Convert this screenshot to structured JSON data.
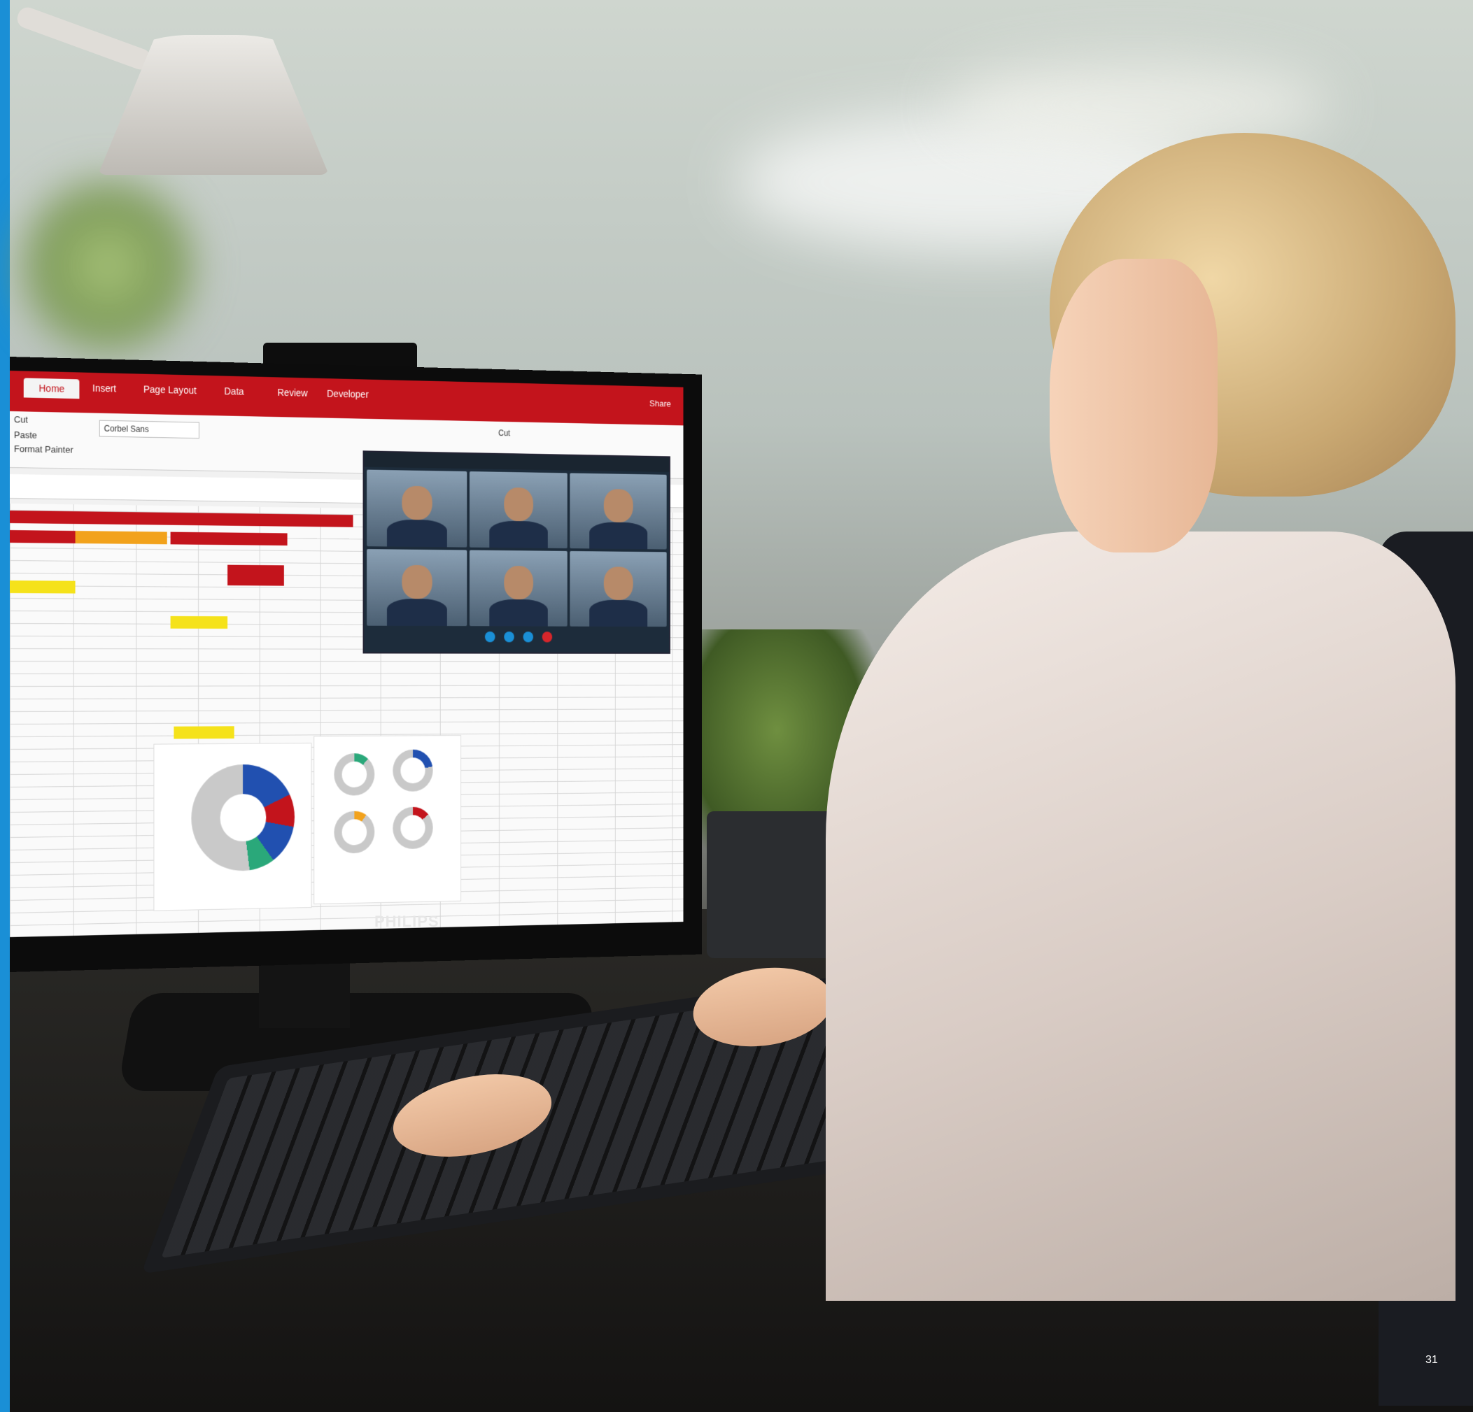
{
  "monitor": {
    "brand": "PHILIPS",
    "ribbon_tabs": [
      "Home",
      "Insert",
      "Page Layout",
      "Data",
      "Review",
      "Developer"
    ],
    "share_label": "Share",
    "clipboard": {
      "cut": "Cut",
      "paste": "Paste",
      "format_painter": "Format Painter"
    },
    "font_name": "Corbel Sans",
    "cut_button": "Cut"
  },
  "page_number": "31",
  "colors": {
    "accent_blue": "#1a8fd6",
    "ribbon_red": "#c3141c"
  }
}
